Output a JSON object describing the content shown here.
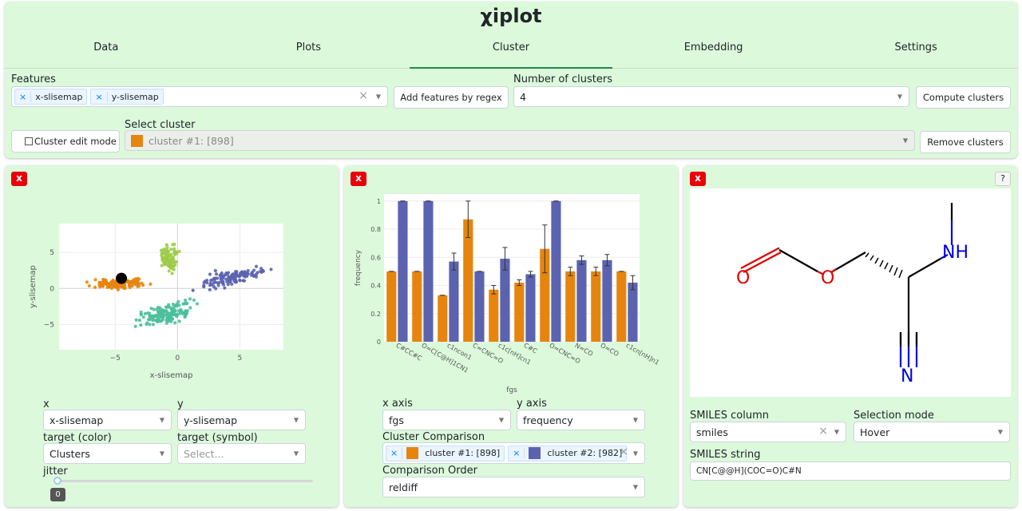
{
  "app": {
    "title": "χiplot"
  },
  "tabs": [
    "Data",
    "Plots",
    "Cluster",
    "Embedding",
    "Settings"
  ],
  "cluster_controls": {
    "features_label": "Features",
    "features_chips": [
      "x-slisemap",
      "y-slisemap"
    ],
    "add_regex_button": "Add features by regex",
    "num_clusters_label": "Number of clusters",
    "num_clusters_value": "4",
    "compute_button": "Compute clusters",
    "edit_mode_label": "Cluster edit mode",
    "select_cluster_label": "Select cluster",
    "select_cluster_value": "cluster #1: [898]",
    "select_cluster_color": "#e6850e",
    "remove_button": "Remove clusters"
  },
  "panel_scatter": {
    "close_label": "x",
    "x_label": "x",
    "x_value": "x-slisemap",
    "y_label": "y",
    "y_value": "y-slisemap",
    "color_label": "target (color)",
    "color_value": "Clusters",
    "symbol_label": "target (symbol)",
    "symbol_placeholder": "Select...",
    "jitter_label": "jitter",
    "jitter_value": "0"
  },
  "panel_bar": {
    "close_label": "x",
    "xaxis_label": "x axis",
    "xaxis_value": "fgs",
    "yaxis_label": "y axis",
    "yaxis_value": "frequency",
    "comparison_label": "Cluster Comparison",
    "comparison_chips": [
      {
        "label": "cluster #1: [898]",
        "color": "#e6850e"
      },
      {
        "label": "cluster #2: [982]",
        "color": "#5b63b0"
      }
    ],
    "order_label": "Comparison Order",
    "order_value": "reldiff"
  },
  "panel_smiles": {
    "close_label": "x",
    "help_label": "?",
    "molecule_atoms": [
      "O",
      "O",
      "NH",
      "N"
    ],
    "smiles_column_label": "SMILES column",
    "smiles_column_value": "smiles",
    "selection_mode_label": "Selection mode",
    "selection_mode_value": "Hover",
    "smiles_string_label": "SMILES string",
    "smiles_string_value": "CN[C@@H](COC=O)C#N"
  },
  "chart_data": [
    {
      "type": "scatter",
      "title": "",
      "xlabel": "x-slisemap",
      "ylabel": "y-slisemap",
      "xlim": [
        -9.5,
        8.5
      ],
      "ylim": [
        -8.5,
        9
      ],
      "xticks": [
        -5,
        0,
        5
      ],
      "yticks": [
        -5,
        0,
        5
      ],
      "grid": true,
      "series": [
        {
          "color": "#e6850e",
          "center": [
            -4.5,
            0.7
          ],
          "spread": [
            1.6,
            0.5
          ],
          "n": 140
        },
        {
          "color": "#9ccc48",
          "center": [
            -0.6,
            4.3
          ],
          "spread": [
            0.6,
            1.3
          ],
          "n": 90
        },
        {
          "color": "#5b63b0",
          "center": [
            4.5,
            1.5
          ],
          "spread": [
            2.2,
            0.8
          ],
          "n": 130
        },
        {
          "color": "#4dbf9c",
          "center": [
            -0.8,
            -3.5
          ],
          "spread": [
            1.7,
            1.1
          ],
          "n": 160
        }
      ],
      "highlight": {
        "x": -4.5,
        "y": 1.4,
        "color": "#000000"
      }
    },
    {
      "type": "bar",
      "title": "",
      "xlabel": "fgs",
      "ylabel": "frequency",
      "ylim": [
        0,
        1.05
      ],
      "yticks": [
        0,
        0.2,
        0.4,
        0.6,
        0.8,
        1
      ],
      "categories": [
        "C#CC#C",
        "O=C[C@H]1CN1",
        "c1ncon1",
        "C=CNC=O",
        "c1c[nH]cn1",
        "C#C",
        "O=CNC=O",
        "N=CO",
        "O=CO",
        "c1cn[nH]n1"
      ],
      "series": [
        {
          "color": "#e6850e",
          "values": [
            0.5,
            0.5,
            0.33,
            0.87,
            0.37,
            0.42,
            0.66,
            0.5,
            0.5,
            0.5
          ],
          "errors": [
            0,
            0,
            0,
            0.13,
            0.03,
            0.02,
            0.17,
            0.03,
            0.03,
            0
          ]
        },
        {
          "color": "#5b63b0",
          "values": [
            1,
            1,
            0.57,
            0.5,
            0.59,
            0.48,
            1,
            0.58,
            0.58,
            0.42
          ],
          "errors": [
            0,
            0,
            0.06,
            0,
            0.08,
            0.02,
            0,
            0.03,
            0.04,
            0.05
          ]
        }
      ]
    }
  ]
}
